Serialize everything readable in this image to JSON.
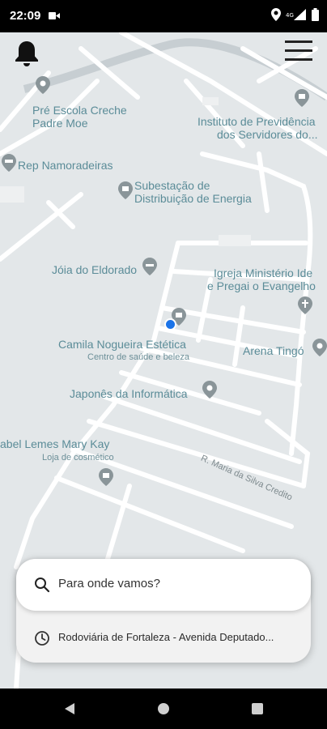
{
  "status_bar": {
    "time": "22:09",
    "icons": [
      "video-icon",
      "location-icon",
      "signal-icon",
      "battery-icon"
    ]
  },
  "map": {
    "labels": {
      "pre_escola": "Pré Escola Creche",
      "pre_escola_2": "Padre Moe",
      "instituto": "Instituto de Previdência",
      "instituto_2": "dos Servidores do...",
      "rep_namoradeiras": "Rep Namoradeiras",
      "subestacao": "Subestação de",
      "subestacao_2": "Distribuição de Energia",
      "joia": "Jóia do Eldorado",
      "igreja": "Igreja Ministério Ide",
      "igreja_2": "e Pregai o Evangelho",
      "camila": "Camila Nogueira Estética",
      "camila_sub": "Centro de saúde e beleza",
      "arena": "Arena Tingó",
      "japones": "Japonês da Informática",
      "mary_kay": "abel Lemes Mary Kay",
      "mary_kay_sub": "Loja de cosmético",
      "street": "R. Maria da Silva Credito"
    }
  },
  "top_controls": {
    "notifications_icon": "bell-icon",
    "menu_icon": "hamburger-menu-icon"
  },
  "search": {
    "placeholder": "Para onde vamos?",
    "recent_destination": "Rodoviária de Fortaleza - Avenida Deputado..."
  },
  "nav_bar": {
    "buttons": [
      "back-icon",
      "home-icon",
      "recents-icon"
    ]
  }
}
